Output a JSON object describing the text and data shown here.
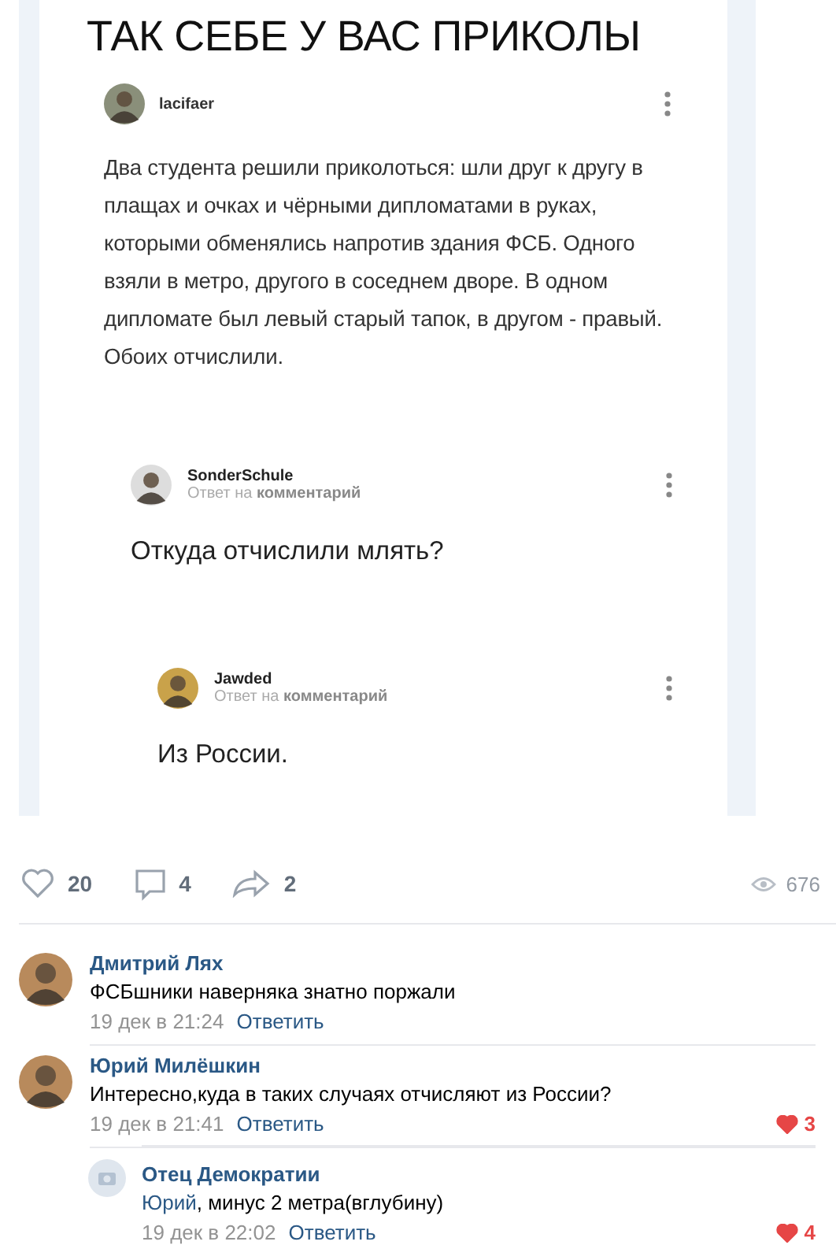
{
  "meme": {
    "title": "ТАК СЕБЕ У ВАС ПРИКОЛЫ",
    "post": {
      "author": "lacifaer",
      "text": "Два студента решили приколоться: шли друг к другу в плащах и очках и чёрными дипломатами в руках, которыми обменялись напротив здания ФСБ. Одного взяли в метро, другого в соседнем дворе. В одном дипломате был левый старый тапок, в другом - правый. Обоих отчислили."
    },
    "replies": [
      {
        "author": "SonderSchule",
        "subtitle": "Ответ на **комментарий**",
        "text": "Откуда отчислили млять?"
      },
      {
        "author": "Jawded",
        "subtitle": "Ответ на **комментарий**",
        "text": "Из России."
      }
    ]
  },
  "actions": {
    "likes": "20",
    "comments": "4",
    "reposts": "2",
    "views": "676"
  },
  "comments": [
    {
      "kind": "photo",
      "author": "Дмитрий Лях",
      "text": "ФСБшники наверняка знатно поржали",
      "time": "19 дек в 21:24",
      "reply": "Ответить",
      "nested": false
    },
    {
      "kind": "photo",
      "author": "Юрий Милёшкин",
      "text": "Интересно,куда в таких случаях отчисляют из России?",
      "time": "19 дек в 21:41",
      "reply": "Ответить",
      "likes": "3",
      "liked": true,
      "nested": false
    },
    {
      "kind": "default",
      "author": "Отец Демократии",
      "reply_to": "Юрий",
      "text": ", минус 2 метра(вглубину)",
      "time": "19 дек в 22:02",
      "reply": "Ответить",
      "likes": "4",
      "liked": true,
      "nested": true
    }
  ]
}
